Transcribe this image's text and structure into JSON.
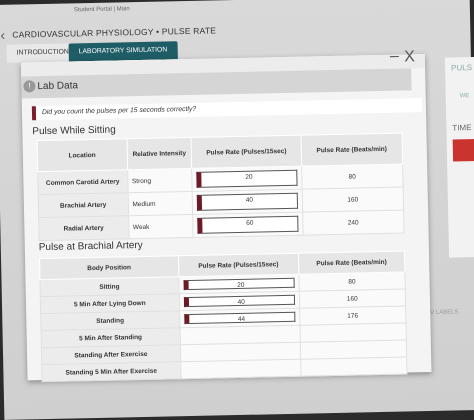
{
  "portal": {
    "label": "Student Portal | Main"
  },
  "breadcrumb": {
    "text": "CARDIOVASCULAR PHYSIOLOGY • PULSE RATE"
  },
  "tabs": [
    {
      "label": "INTRODUCTION"
    },
    {
      "label": "LABORATORY SIMULATION"
    }
  ],
  "right_panel": {
    "title": "PULS",
    "sub": "WE",
    "time": "TIME",
    "labels": "V LABELS"
  },
  "modal": {
    "title": "Lab Data",
    "question": "Did you count the pulses per 15 seconds correctly?",
    "close": "X",
    "minimize": "–"
  },
  "sitting": {
    "title": "Pulse While Sitting",
    "headers": [
      "Location",
      "Relative Intensity",
      "Pulse Rate (Pulses/15sec)",
      "Pulse Rate (Beats/min)"
    ],
    "rows": [
      {
        "location": "Common Carotid Artery",
        "intensity": "Strong",
        "pulse15": "20",
        "bpm": "80"
      },
      {
        "location": "Brachial Artery",
        "intensity": "Medium",
        "pulse15": "40",
        "bpm": "160"
      },
      {
        "location": "Radial Artery",
        "intensity": "Weak",
        "pulse15": "60",
        "bpm": "240"
      }
    ]
  },
  "brachial": {
    "title": "Pulse at Brachial Artery",
    "headers": [
      "Body Position",
      "Pulse Rate (Pulses/15sec)",
      "Pulse Rate (Beats/min)"
    ],
    "rows": [
      {
        "position": "Sitting",
        "pulse15": "20",
        "bpm": "80"
      },
      {
        "position": "5 Min After Lying Down",
        "pulse15": "40",
        "bpm": "160"
      },
      {
        "position": "Standing",
        "pulse15": "44",
        "bpm": "176"
      },
      {
        "position": "5 Min After Standing",
        "pulse15": "",
        "bpm": ""
      },
      {
        "position": "Standing After Exercise",
        "pulse15": "",
        "bpm": ""
      },
      {
        "position": "Standing 5 Min After Exercise",
        "pulse15": "",
        "bpm": ""
      }
    ]
  }
}
